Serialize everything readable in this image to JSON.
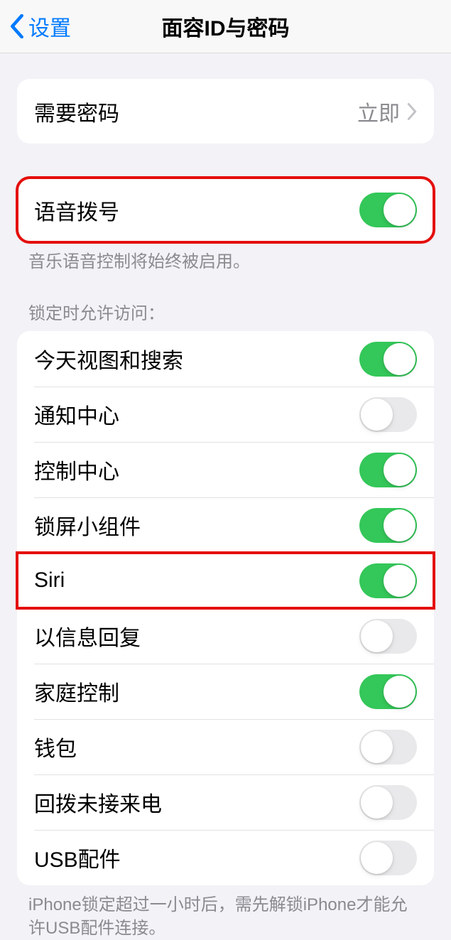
{
  "nav": {
    "back_label": "设置",
    "title": "面容ID与密码"
  },
  "passcode_section": {
    "require_passcode": {
      "label": "需要密码",
      "value": "立即"
    }
  },
  "voice_dial_section": {
    "item": {
      "label": "语音拨号",
      "on": true
    },
    "footer": "音乐语音控制将始终被启用。"
  },
  "lock_access_section": {
    "header": "锁定时允许访问：",
    "items": [
      {
        "label": "今天视图和搜索",
        "on": true,
        "highlight": false
      },
      {
        "label": "通知中心",
        "on": false,
        "highlight": false
      },
      {
        "label": "控制中心",
        "on": true,
        "highlight": false
      },
      {
        "label": "锁屏小组件",
        "on": true,
        "highlight": false
      },
      {
        "label": "Siri",
        "on": true,
        "highlight": true
      },
      {
        "label": "以信息回复",
        "on": false,
        "highlight": false
      },
      {
        "label": "家庭控制",
        "on": true,
        "highlight": false
      },
      {
        "label": "钱包",
        "on": false,
        "highlight": false
      },
      {
        "label": "回拨未接来电",
        "on": false,
        "highlight": false
      },
      {
        "label": "USB配件",
        "on": false,
        "highlight": false
      }
    ],
    "footer": "iPhone锁定超过一小时后，需先解锁iPhone才能允许USB配件连接。"
  }
}
